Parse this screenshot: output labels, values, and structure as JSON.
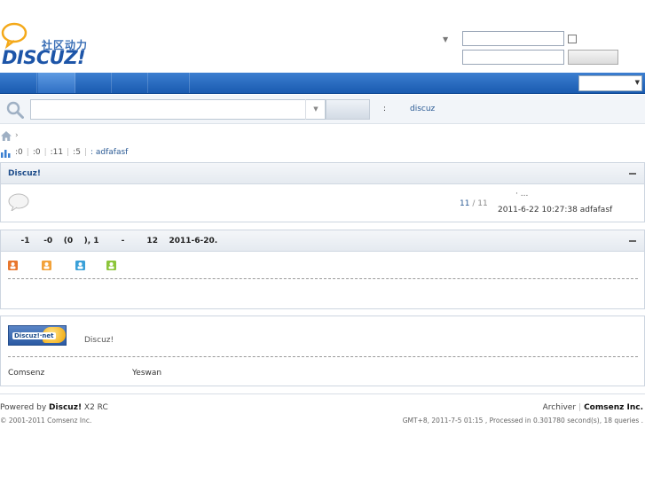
{
  "header": {
    "logo_cn": "社区动力",
    "logo_en": "DISCUZ!"
  },
  "search": {
    "hot_colon": ":",
    "hot_link": "discuz"
  },
  "stats": {
    "items": [
      ":0",
      ":0",
      ":11",
      ":5"
    ],
    "newest_member": ": adfafasf"
  },
  "forum_section": {
    "title": "Discuz!",
    "count": "11",
    "count_sep": "/",
    "count_total": "11",
    "last_post_title": "·  ...",
    "last_post_time": "2011-6-22 10:27:38 adfafasf"
  },
  "online": {
    "title": "    -1     -0    (0    ), 1        -        12    2011-6-20.",
    "legend_colors": [
      "#e8772e",
      "#f2a23a",
      "#3aa0d8",
      "#8cc53a"
    ]
  },
  "links": {
    "logo_text": "Discuz!·net",
    "desc": "Discuz!",
    "items": [
      "Comsenz",
      "Yeswan"
    ]
  },
  "footer": {
    "powered_prefix": "Powered by",
    "brand": "Discuz!",
    "version": "X2 RC",
    "copyright": "© 2001-2011 Comsenz Inc.",
    "archiver": "Archiver",
    "company": "Comsenz Inc.",
    "debug": "GMT+8, 2011-7-5 01:15 , Processed in 0.301780 second(s), 18 queries ."
  }
}
